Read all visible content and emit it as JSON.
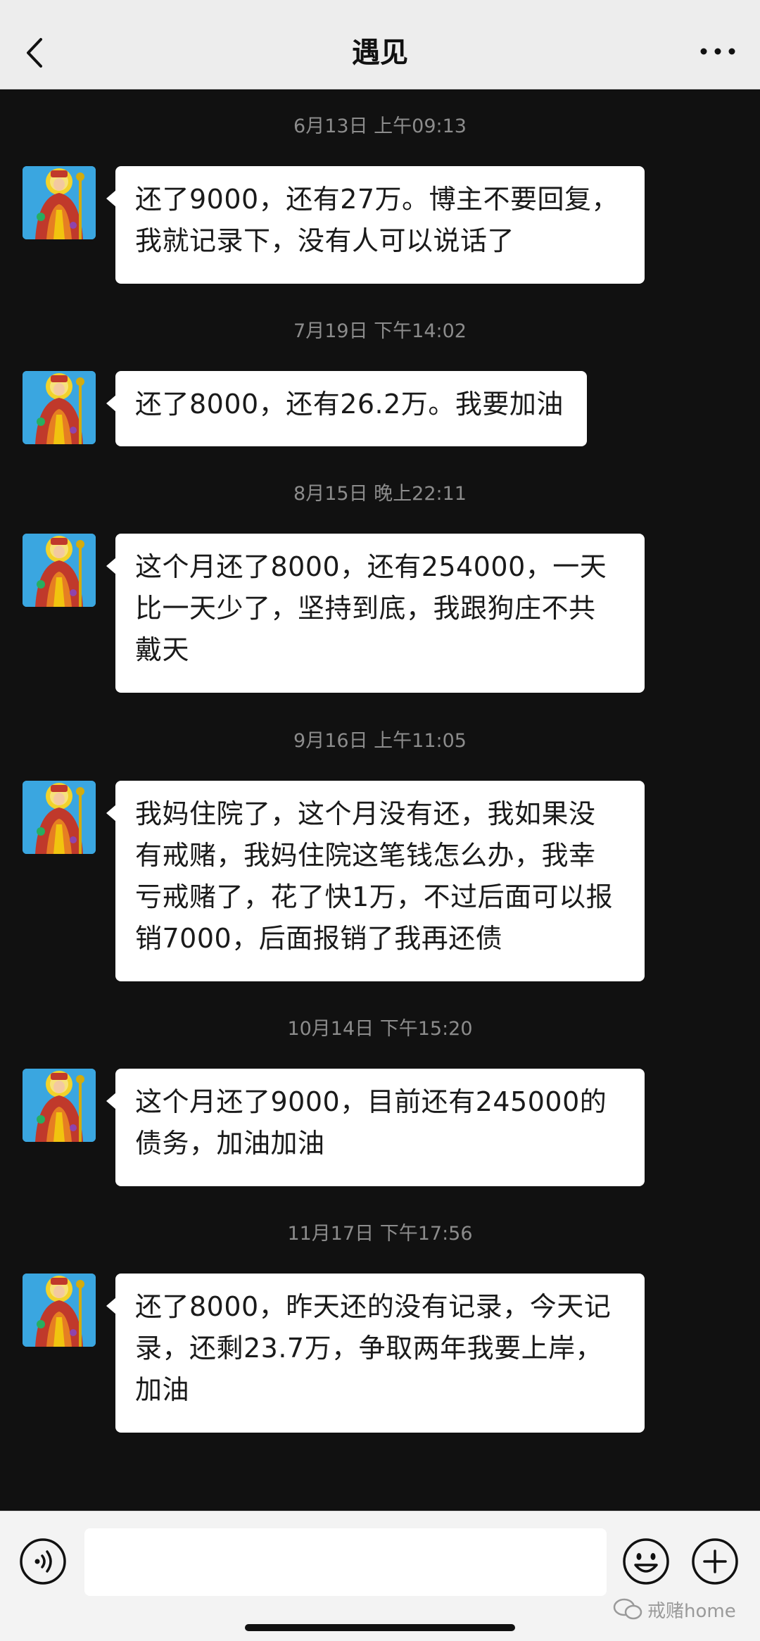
{
  "header": {
    "title": "遇见",
    "back_icon": "chevron-left-icon",
    "more_icon": "more-horizontal-icon"
  },
  "messages": [
    {
      "timestamp": "6月13日 上午09:13",
      "text": "还了9000，还有27万。博主不要回复，\n我就记录下，没有人可以说话了"
    },
    {
      "timestamp": "7月19日 下午14:02",
      "text": "还了8000，还有26.2万。我要加油"
    },
    {
      "timestamp": "8月15日 晚上22:11",
      "text": "这个月还了8000，还有254000，一天\n比一天少了，坚持到底，我跟狗庄不共\n戴天"
    },
    {
      "timestamp": "9月16日 上午11:05",
      "text": "我妈住院了，这个月没有还，我如果没\n有戒赌，我妈住院这笔钱怎么办，我幸\n亏戒赌了，花了快1万，不过后面可以报\n销7000，后面报销了我再还债"
    },
    {
      "timestamp": "10月14日 下午15:20",
      "text": "这个月还了9000，目前还有245000的\n债务，加油加油"
    },
    {
      "timestamp": "11月17日 下午17:56",
      "text": "还了8000，昨天还的没有记录，今天记\n录，还剩23.7万，争取两年我要上岸，\n加油"
    }
  ],
  "input_bar": {
    "voice_icon": "voice-icon",
    "input_value": "",
    "emoji_icon": "emoji-icon",
    "plus_icon": "plus-icon"
  },
  "watermark": {
    "text": "戒赌home"
  },
  "colors": {
    "header_bg": "#ededed",
    "chat_bg": "#111111",
    "bubble_bg": "#ffffff",
    "timestamp": "#8c8c8c",
    "avatar_bg": "#3aa6e0"
  }
}
